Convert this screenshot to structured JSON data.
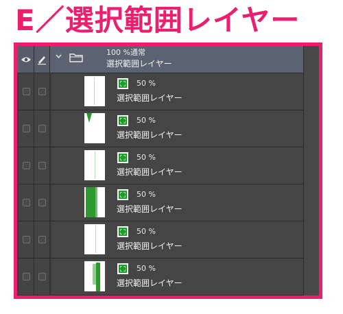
{
  "heading": "E／選択範囲レイヤー",
  "colors": {
    "accent": "#ec1f6e",
    "panel_bg": "#454545",
    "folder_bg": "#5b6372",
    "mask_green": "#1f9b2b",
    "thumb_green": "#2d9a2d"
  },
  "folder": {
    "blend": "100 %通常",
    "name": "選択範囲レイヤー",
    "icons": {
      "visibility": "eye-icon",
      "lock": "pen-icon",
      "expand": "chevron-down-icon",
      "folder": "folder-icon"
    }
  },
  "layers": [
    {
      "opacity": "50 %",
      "name": "選択範囲レイヤー",
      "thumb": "faint-line"
    },
    {
      "opacity": "50 %",
      "name": "選択範囲レイヤー",
      "thumb": "corner-wedge"
    },
    {
      "opacity": "50 %",
      "name": "選択範囲レイヤー",
      "thumb": "faint-line"
    },
    {
      "opacity": "50 %",
      "name": "選択範囲レイヤー",
      "thumb": "wide-band"
    },
    {
      "opacity": "50 %",
      "name": "選択範囲レイヤー",
      "thumb": "faint-line"
    },
    {
      "opacity": "50 %",
      "name": "選択範囲レイヤー",
      "thumb": "right-band"
    }
  ]
}
